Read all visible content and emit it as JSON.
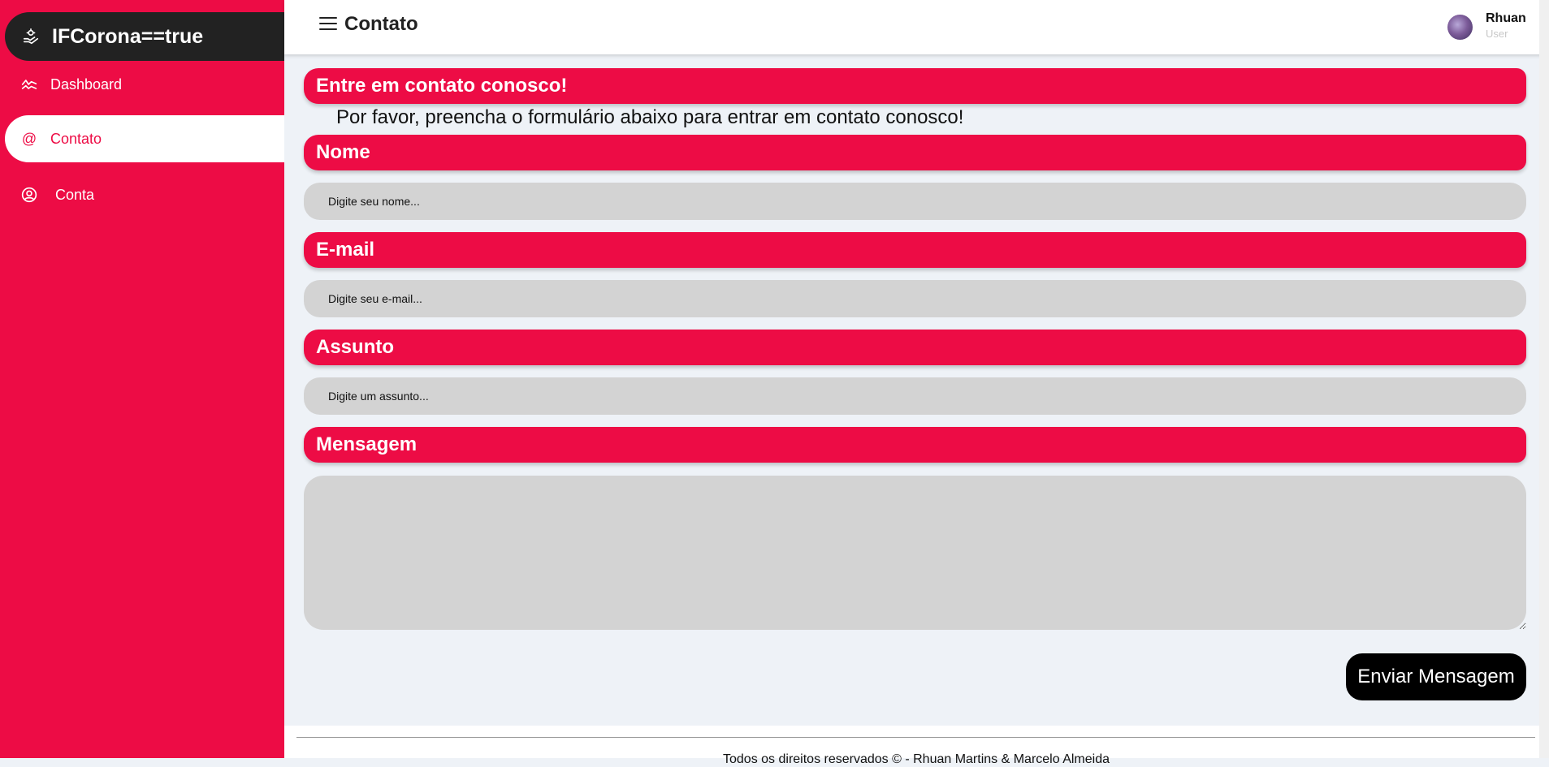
{
  "sidebar": {
    "brand": {
      "title": "IFCorona==true",
      "icon": "virus-hand-icon"
    },
    "items": [
      {
        "label": "Dashboard",
        "icon": "chart-line-icon",
        "active": false
      },
      {
        "label": "Contato",
        "icon": "at-icon",
        "active": true
      },
      {
        "label": "Conta",
        "icon": "user-circle-icon",
        "active": false
      }
    ]
  },
  "topbar": {
    "title": "Contato",
    "user": {
      "name": "Rhuan",
      "role": "User"
    }
  },
  "form": {
    "header": "Entre em contato conosco!",
    "intro": "Por favor, preencha o formulário abaixo para entrar em contato conosco!",
    "fields": [
      {
        "label": "Nome",
        "placeholder": "Digite seu nome..."
      },
      {
        "label": "E-mail",
        "placeholder": "Digite seu e-mail..."
      },
      {
        "label": "Assunto",
        "placeholder": "Digite um assunto..."
      }
    ],
    "message_label": "Mensagem",
    "submit_label": "Enviar Mensagem"
  },
  "footer": {
    "text": "Todos os direitos reservados ©  - Rhuan Martins & Marcelo Almeida"
  },
  "colors": {
    "accent": "#ed0c45",
    "brand_bg": "#222222",
    "input_bg": "#d3d3d3",
    "page_bg": "#eef2f7"
  }
}
